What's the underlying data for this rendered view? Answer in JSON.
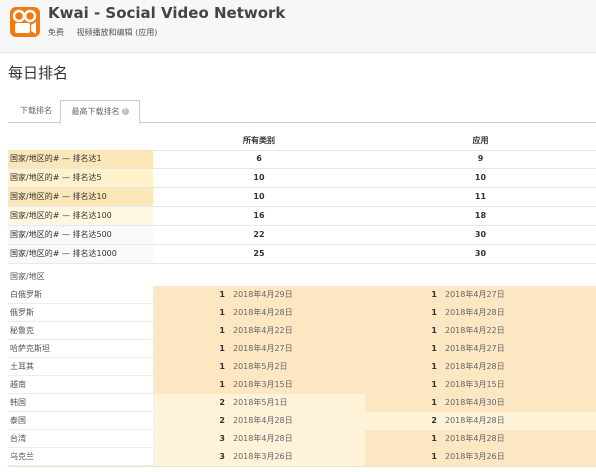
{
  "app": {
    "title": "Kwai - Social Video Network",
    "meta": [
      "免费",
      "视频播放和编辑 (应用)"
    ],
    "brand_color": "#f07a13"
  },
  "page": {
    "title": "每日排名"
  },
  "tabs": [
    {
      "label": "下载排名"
    },
    {
      "label": "最高下载排名"
    }
  ],
  "table": {
    "columns": [
      "所有类别",
      "应用"
    ],
    "summary_rows": [
      {
        "label": "国家/地区的# — 排名达1",
        "all": "6",
        "app": "9"
      },
      {
        "label": "国家/地区的# — 排名达5",
        "all": "10",
        "app": "10"
      },
      {
        "label": "国家/地区的# — 排名达10",
        "all": "10",
        "app": "11"
      },
      {
        "label": "国家/地区的# — 排名达100",
        "all": "16",
        "app": "18"
      },
      {
        "label": "国家/地区的# — 排名达500",
        "all": "22",
        "app": "30"
      },
      {
        "label": "国家/地区的# — 排名达1000",
        "all": "25",
        "app": "30"
      }
    ],
    "country_header": "国家/地区",
    "country_rows": [
      {
        "country": "白俄罗斯",
        "all_rank": "1",
        "all_date": "2018年4月29日",
        "app_rank": "1",
        "app_date": "2018年4月27日"
      },
      {
        "country": "俄罗斯",
        "all_rank": "1",
        "all_date": "2018年4月28日",
        "app_rank": "1",
        "app_date": "2018年4月28日"
      },
      {
        "country": "秘鲁克",
        "all_rank": "1",
        "all_date": "2018年4月22日",
        "app_rank": "1",
        "app_date": "2018年4月22日"
      },
      {
        "country": "哈萨克斯坦",
        "all_rank": "1",
        "all_date": "2018年4月27日",
        "app_rank": "1",
        "app_date": "2018年4月27日"
      },
      {
        "country": "土耳其",
        "all_rank": "1",
        "all_date": "2018年5月2日",
        "app_rank": "1",
        "app_date": "2018年4月28日"
      },
      {
        "country": "越南",
        "all_rank": "1",
        "all_date": "2018年3月15日",
        "app_rank": "1",
        "app_date": "2018年3月15日"
      },
      {
        "country": "韩国",
        "all_rank": "2",
        "all_date": "2018年5月1日",
        "app_rank": "1",
        "app_date": "2018年4月30日"
      },
      {
        "country": "泰国",
        "all_rank": "2",
        "all_date": "2018年4月28日",
        "app_rank": "2",
        "app_date": "2018年4月28日"
      },
      {
        "country": "台湾",
        "all_rank": "3",
        "all_date": "2018年4月28日",
        "app_rank": "1",
        "app_date": "2018年4月28日"
      },
      {
        "country": "乌克兰",
        "all_rank": "3",
        "all_date": "2018年3月26日",
        "app_rank": "1",
        "app_date": "2018年3月26日"
      }
    ]
  }
}
